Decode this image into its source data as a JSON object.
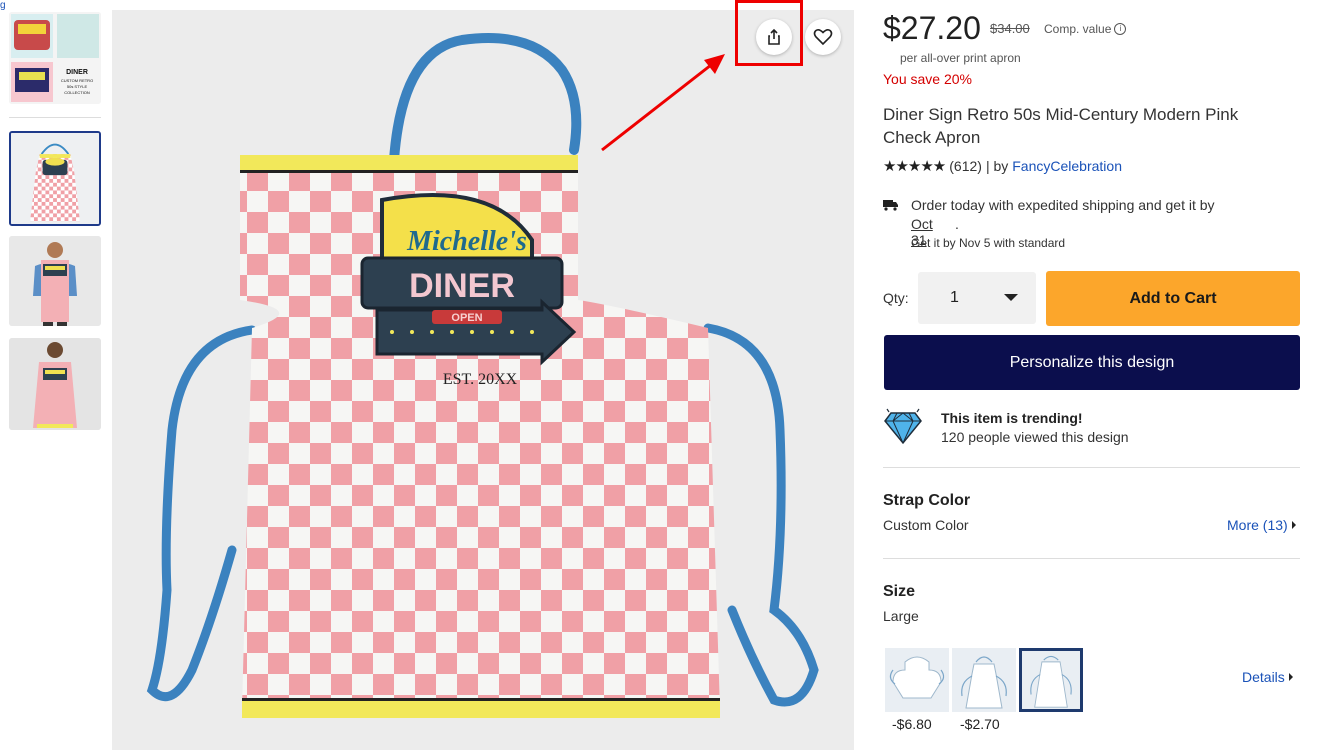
{
  "price": {
    "current": "$27.20",
    "original": "$34.00",
    "comp_label": "Comp. value",
    "per_unit": "per all-over print apron",
    "savings": "You save 20%"
  },
  "product": {
    "title": "Diner Sign Retro 50s Mid-Century Modern Pink Check Apron",
    "stars": "★★★★★",
    "rating_count": "(612)",
    "by_label": "| by",
    "seller": "FancyCelebration"
  },
  "apron_graphic": {
    "name": "Michelle's",
    "sign": "DINER",
    "open": "OPEN",
    "est": "EST. 20XX"
  },
  "thumbnail_text": {
    "t1": "DINER",
    "t2": "CUSTOM RETRO",
    "t3": "50s STYLE",
    "t4": "COLLECTION"
  },
  "shipping": {
    "line1": "Order today with expedited shipping and get it by",
    "date": "Oct 31",
    "period": ".",
    "standard": "Get it by Nov 5 with standard"
  },
  "quantity": {
    "label": "Qty:",
    "value": "1"
  },
  "buttons": {
    "add_to_cart": "Add to Cart",
    "personalize": "Personalize this design"
  },
  "trending": {
    "title": "This item is trending!",
    "subtitle": "120 people viewed this design"
  },
  "strap_color": {
    "heading": "Strap Color",
    "value": "Custom Color",
    "more": "More (13)"
  },
  "size": {
    "heading": "Size",
    "value": "Large",
    "details": "Details",
    "options": [
      {
        "price": "-$6.80"
      },
      {
        "price": "-$2.70"
      },
      {
        "price": ""
      }
    ]
  },
  "colors": {
    "save_red": "#d40000",
    "cart_orange": "#fca62b",
    "personalize_navy": "#0b0e4d",
    "link_blue": "#1a52b8",
    "annotation_red": "#e00000"
  },
  "icons": [
    "share-icon",
    "heart-icon",
    "truck-icon",
    "diamond-icon",
    "info-icon",
    "chevron-down-icon",
    "caret-right-icon"
  ]
}
